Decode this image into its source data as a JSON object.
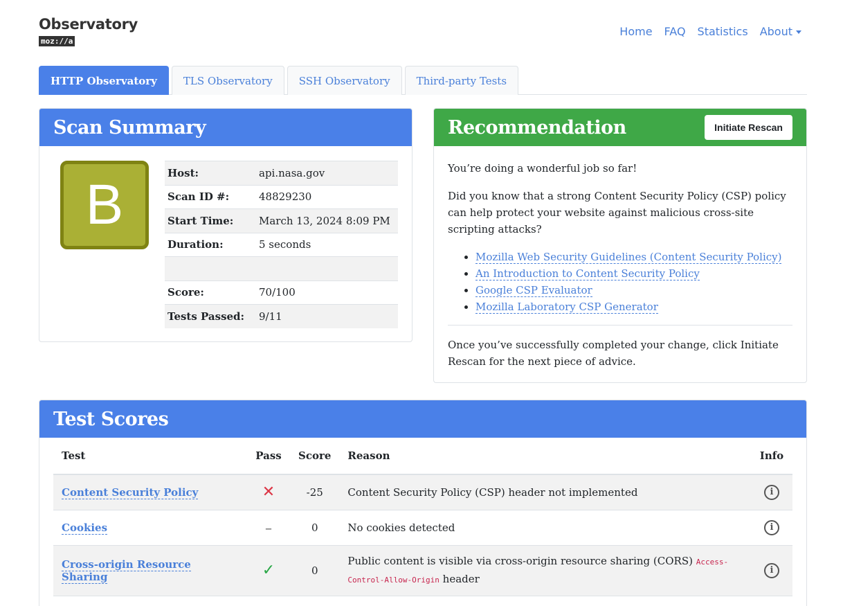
{
  "logo": {
    "title": "Observatory",
    "badge": "moz://a"
  },
  "nav": {
    "home": "Home",
    "faq": "FAQ",
    "statistics": "Statistics",
    "about": "About"
  },
  "tabs": [
    "HTTP Observatory",
    "TLS Observatory",
    "SSH Observatory",
    "Third-party Tests"
  ],
  "summary": {
    "title": "Scan Summary",
    "grade": "B",
    "rows": [
      {
        "key": "Host:",
        "value": "api.nasa.gov"
      },
      {
        "key": "Scan ID #:",
        "value": "48829230"
      },
      {
        "key": "Start Time:",
        "value": "March 13, 2024 8:09 PM"
      },
      {
        "key": "Duration:",
        "value": "5 seconds"
      },
      {
        "key": "",
        "value": ""
      },
      {
        "key": "Score:",
        "value": "70/100"
      },
      {
        "key": "Tests Passed:",
        "value": "9/11"
      }
    ]
  },
  "recommendation": {
    "title": "Recommendation",
    "rescan_label": "Initiate Rescan",
    "intro": "You’re doing a wonderful job so far!",
    "body": "Did you know that a strong Content Security Policy (CSP) policy can help protect your website against malicious cross-site scripting attacks?",
    "links": [
      "Mozilla Web Security Guidelines (Content Security Policy)",
      "An Introduction to Content Security Policy",
      "Google CSP Evaluator",
      "Mozilla Laboratory CSP Generator"
    ],
    "footer": "Once you’ve successfully completed your change, click Initiate Rescan for the next piece of advice."
  },
  "scores": {
    "title": "Test Scores",
    "headers": {
      "test": "Test",
      "pass": "Pass",
      "score": "Score",
      "reason": "Reason",
      "info": "Info"
    },
    "rows": [
      {
        "test": "Content Security Policy",
        "pass": "fail",
        "score": "-25",
        "reason": "Content Security Policy (CSP) header not implemented"
      },
      {
        "test": "Cookies",
        "pass": "neutral",
        "score": "0",
        "reason": "No cookies detected"
      },
      {
        "test": "Cross-origin Resource Sharing",
        "pass": "pass",
        "score": "0",
        "reason": "Public content is visible via cross-origin resource sharing (CORS)",
        "code": "Access-Control-Allow-Origin",
        "reason_suffix": "header"
      }
    ]
  },
  "colors": {
    "accent_blue": "#4a80e8",
    "accent_green": "#3fa847",
    "grade": "#aab035",
    "fail": "#dc3545",
    "pass": "#28a745"
  }
}
